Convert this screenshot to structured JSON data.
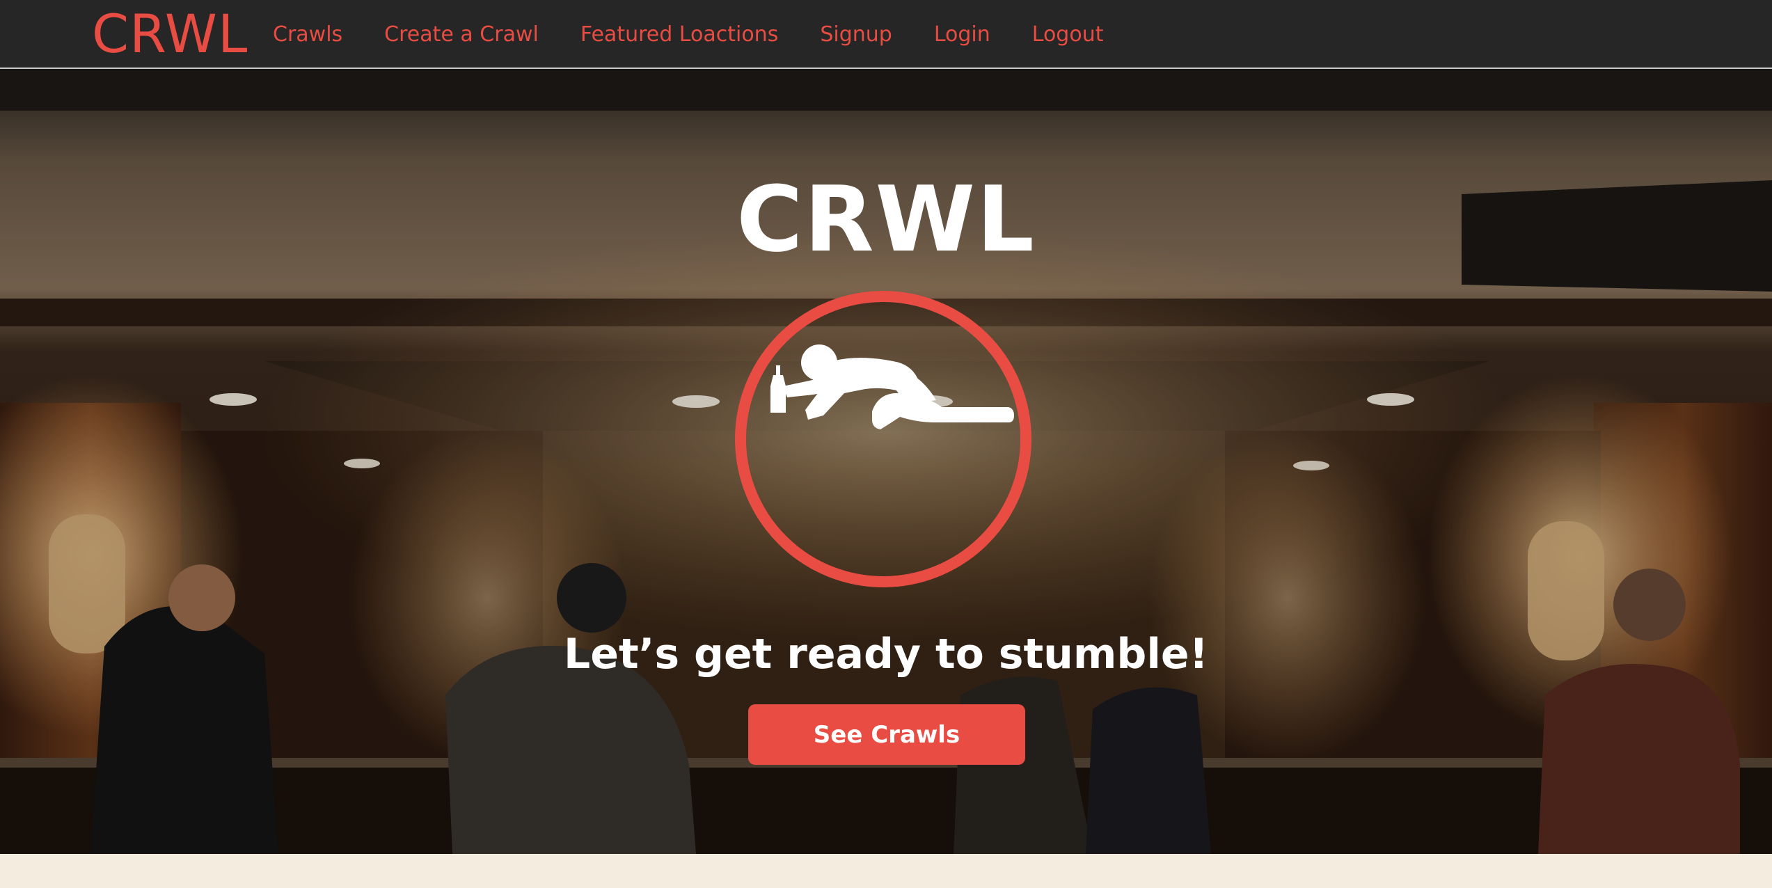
{
  "navbar": {
    "brand": "CRWL",
    "links": [
      {
        "label": "Crawls"
      },
      {
        "label": "Create a Crawl"
      },
      {
        "label": "Featured Loactions"
      },
      {
        "label": "Signup"
      },
      {
        "label": "Login"
      },
      {
        "label": "Logout"
      }
    ]
  },
  "hero": {
    "title": "CRWL",
    "logo_icon": "crawling-person-with-bottle-icon",
    "tagline": "Let’s get ready to stumble!",
    "cta_label": "See Crawls",
    "background": "bar-interior-photo"
  },
  "colors": {
    "accent": "#e84c43",
    "navbar_bg": "#262626",
    "page_bg": "#f5ece0",
    "text_light": "#ffffff"
  }
}
